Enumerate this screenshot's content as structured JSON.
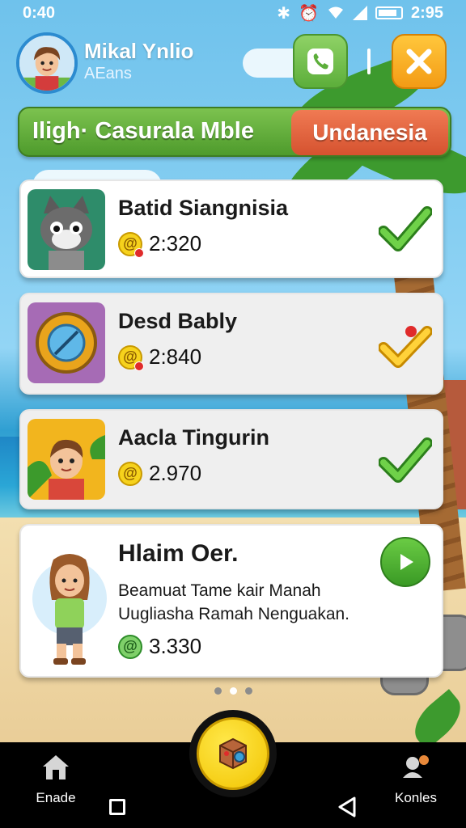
{
  "status_bar": {
    "time": "0:40",
    "clock": "2:95"
  },
  "profile": {
    "name": "Mikal Ynlio",
    "subtitle": "AEans"
  },
  "banner": {
    "title": "Iligh· Casurala Mble",
    "tag": "Undanesia"
  },
  "cards": [
    {
      "title": "Batid Siangnisia",
      "coins": "2:320",
      "status": "check-green"
    },
    {
      "title": "Desd Bably",
      "coins": "2:840",
      "status": "check-yellow"
    },
    {
      "title": "Aacla Tingurin",
      "coins": "2.970",
      "status": "check-green"
    }
  ],
  "featured": {
    "title": "Hlaim Oer.",
    "description": "Beamuat Tame kair Manah Uugliasha Ramah Nenguakan.",
    "coins": "3.330"
  },
  "pager": {
    "count": 3,
    "active": 1
  },
  "bottom_nav": {
    "home_label": "Enade",
    "right_label": "Konles"
  },
  "colors": {
    "green": "#5cae3a",
    "orange": "#d5522f",
    "yellow": "#f2c400"
  }
}
